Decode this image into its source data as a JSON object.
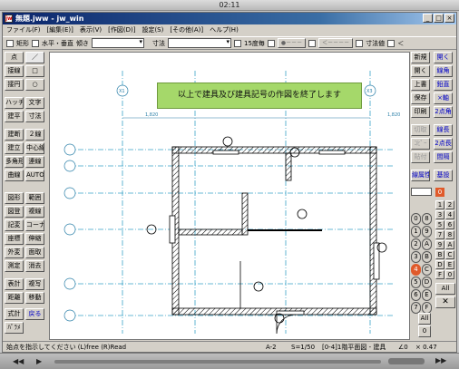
{
  "player": {
    "time": "02:11"
  },
  "window": {
    "title": "無題.jww - jw_win",
    "icon_text": "jw",
    "min": "_",
    "max": "□",
    "close": "×"
  },
  "menu": [
    "ファイル(F)",
    "[編集(E)]",
    "表示(V)",
    "[作図(D)]",
    "設定(S)",
    "[その他(A)]",
    "ヘルプ(H)"
  ],
  "toolbar": {
    "rect": "矩形",
    "hv": "水平・垂直",
    "angle": "傾き",
    "dim": "寸法",
    "deg15": "15度毎",
    "btn1": "●－－－",
    "btn2": "＜－－－－",
    "dimvalue": "寸法値",
    "lt": "＜"
  },
  "left_tools": [
    [
      "点",
      "／"
    ],
    [
      "接線",
      "□"
    ],
    [
      "接円",
      "○"
    ],
    [
      "ハッチ",
      "文字"
    ],
    [
      "建平",
      "寸法"
    ],
    [
      "建断",
      "２線"
    ],
    [
      "建立",
      "中心線"
    ],
    [
      "多角形",
      "連線"
    ],
    [
      "曲線",
      "AUTO"
    ],
    [
      "図形",
      "範囲"
    ],
    [
      "図登",
      "複線"
    ],
    [
      "記変",
      "コーナー"
    ],
    [
      "座標",
      "伸縮"
    ],
    [
      "外変",
      "面取"
    ],
    [
      "測定",
      "消去"
    ],
    [
      "表計",
      "複写"
    ],
    [
      "距離",
      "移動"
    ],
    [
      "式計",
      "戻る"
    ],
    [
      "ﾊﾟﾗﾒ",
      ""
    ],
    [
      "日影",
      ""
    ]
  ],
  "right_tools": [
    [
      "新規",
      "開く"
    ],
    [
      "開く",
      "線角"
    ],
    [
      "上書",
      "鉛直"
    ],
    [
      "保存",
      "×軸"
    ],
    [
      "印刷",
      "2点角"
    ],
    [
      "切取",
      "線長"
    ],
    [
      "ｺﾋﾟｰ",
      "2点長"
    ],
    [
      "貼付",
      "間隔"
    ],
    [
      "線属性",
      "基設"
    ]
  ],
  "layers": {
    "numbers_left": [
      "0",
      "1",
      "2",
      "3",
      "4",
      "5",
      "6",
      "7"
    ],
    "numbers_right": [
      "8",
      "9",
      "A",
      "B",
      "C",
      "D",
      "E",
      "F"
    ],
    "grid_right": [
      "0",
      "1",
      "2",
      "3",
      "4",
      "5",
      "6",
      "7",
      "8",
      "9",
      "A",
      "B",
      "C",
      "D",
      "E",
      "F"
    ],
    "all": "All",
    "zero": "0"
  },
  "message": "以上で建具及び建具記号の作図を終了します",
  "axis_labels": {
    "x1": "X1",
    "x2": "X2",
    "x3": "X3",
    "dim1": "1,820",
    "dim2": "1,820",
    "dim3": "1,820"
  },
  "status": {
    "hint": "始点を指示してください (L)free (R)Read",
    "paper": "A-2",
    "scale": "S=1/50",
    "layer": "[0-4]1階平面図 - 建具",
    "angle": "∠0",
    "zoom": "× 0.47"
  }
}
